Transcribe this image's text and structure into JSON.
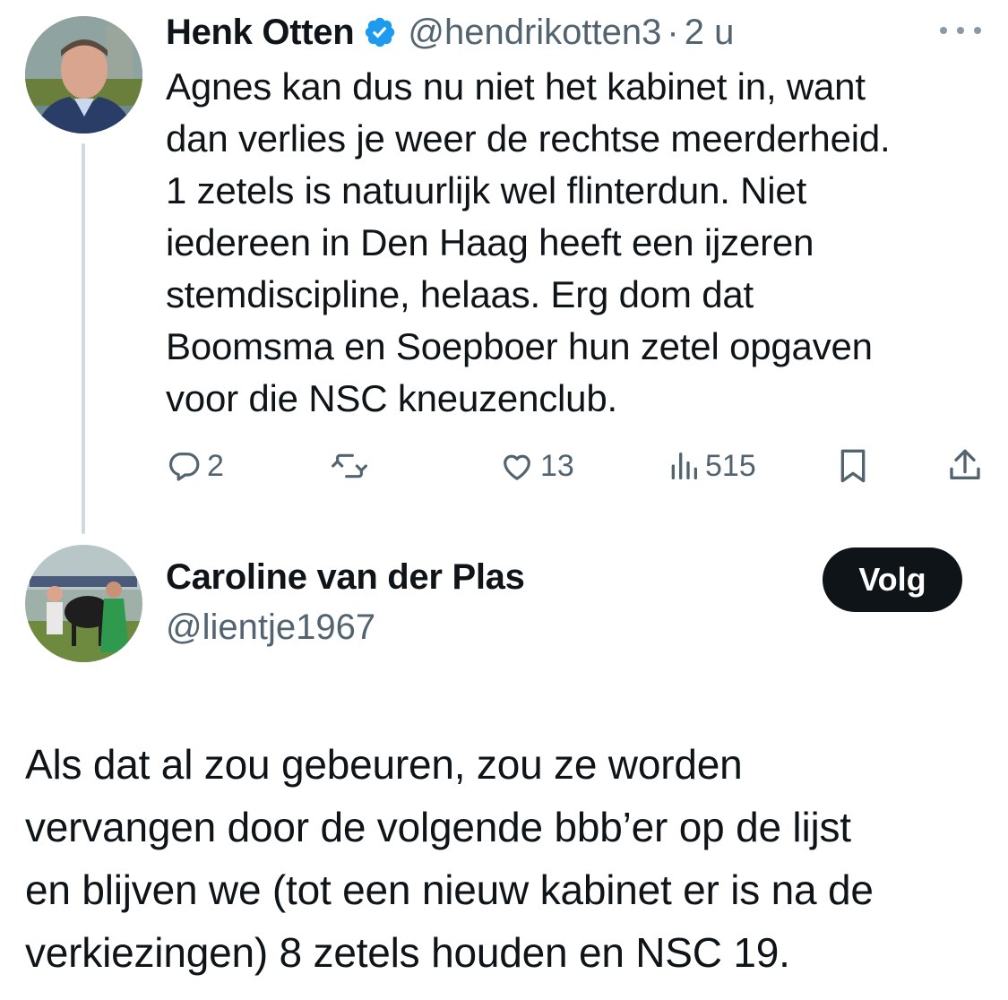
{
  "parent_tweet": {
    "author": {
      "name": "Henk Otten",
      "handle": "@hendrikotten3",
      "verified": true
    },
    "separator": "·",
    "time": "2 u",
    "text": "Agnes kan dus nu niet het kabinet in, want\ndan verlies je weer de rechtse meerderheid.\n1 zetels is natuurlijk wel flinterdun. Niet\niedereen in Den Haag heeft een ijzeren\nstemdiscipline, helaas. Erg dom dat\nBoomsma en Soepboer hun zetel opgaven\nvoor die NSC kneuzenclub.",
    "actions": {
      "replies": "2",
      "reposts": "",
      "likes": "13",
      "views": "515"
    }
  },
  "reply_tweet": {
    "author": {
      "name": "Caroline van der Plas",
      "handle": "@lientje1967"
    },
    "follow_label": "Volg",
    "text": "Als dat al zou gebeuren, zou ze worden\nvervangen door de volgende bbb’er op de lijst\nen blijven we (tot een nieuw kabinet er is na de\nverkiezingen) 8 zetels houden en NSC 19."
  },
  "colors": {
    "verified_badge": "#1d9bf0",
    "secondary_text": "#536471",
    "thread_line": "#cfd9de",
    "follow_button_bg": "#0f1419"
  },
  "icons": [
    "more-icon",
    "verified-badge-icon",
    "reply-icon",
    "repost-icon",
    "like-icon",
    "views-icon",
    "bookmark-icon",
    "share-icon"
  ]
}
